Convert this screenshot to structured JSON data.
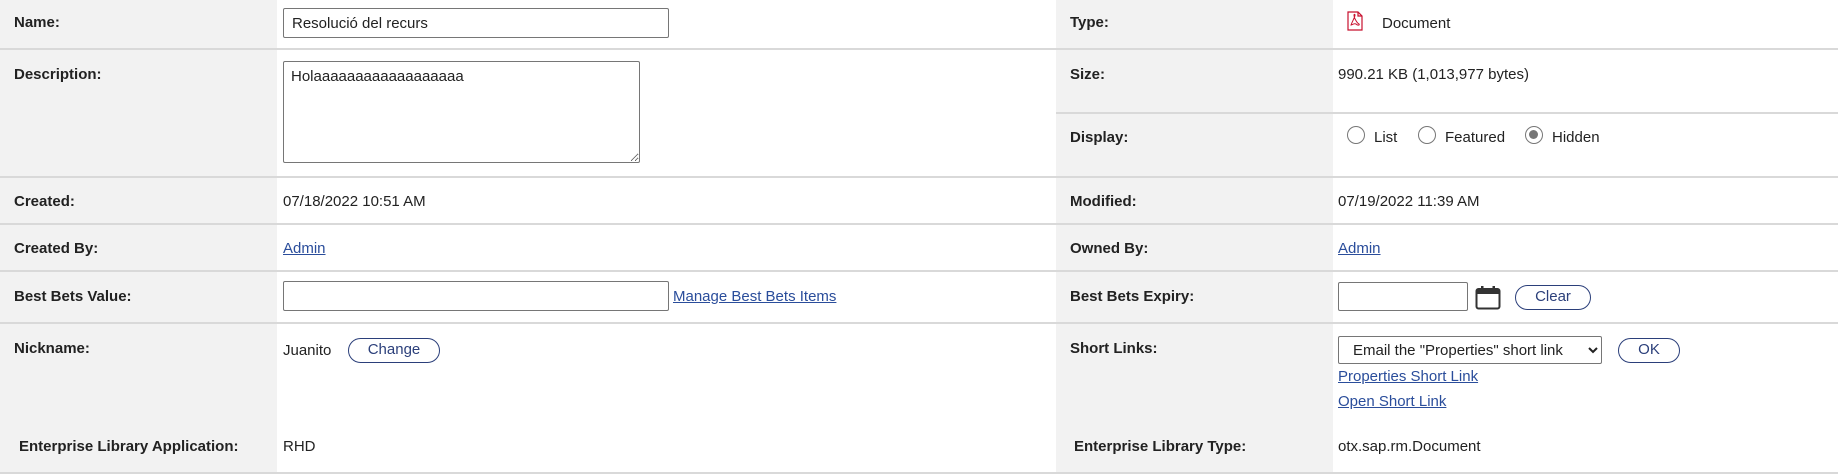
{
  "name": {
    "label": "Name:",
    "value": "Resolució del recurs"
  },
  "type": {
    "label": "Type:",
    "value": "Document",
    "icon": "pdf-icon"
  },
  "description": {
    "label": "Description:",
    "value": "Holaaaaaaaaaaaaaaaaaa"
  },
  "size": {
    "label": "Size:",
    "value": "990.21 KB (1,013,977 bytes)"
  },
  "display": {
    "label": "Display:",
    "options": [
      "List",
      "Featured",
      "Hidden"
    ],
    "selected": "Hidden"
  },
  "created": {
    "label": "Created:",
    "value": "07/18/2022 10:51 AM"
  },
  "modified": {
    "label": "Modified:",
    "value": "07/19/2022 11:39 AM"
  },
  "created_by": {
    "label": "Created By:",
    "value": "Admin"
  },
  "owned_by": {
    "label": "Owned By:",
    "value": "Admin"
  },
  "best_bets_value": {
    "label": "Best Bets Value:",
    "value": "",
    "link": "Manage Best Bets Items"
  },
  "best_bets_expiry": {
    "label": "Best Bets Expiry:",
    "value": "",
    "clear_label": "Clear",
    "icon": "calendar-icon"
  },
  "nickname": {
    "label": "Nickname:",
    "value": "Juanito",
    "change_label": "Change"
  },
  "short_links": {
    "label": "Short Links:",
    "select_value": "Email the \"Properties\" short link",
    "ok_label": "OK",
    "links": [
      "Properties Short Link",
      "Open Short Link"
    ]
  },
  "el_application": {
    "label": "Enterprise Library Application:",
    "value": "RHD"
  },
  "el_type": {
    "label": "Enterprise Library Type:",
    "value": "otx.sap.rm.Document"
  }
}
